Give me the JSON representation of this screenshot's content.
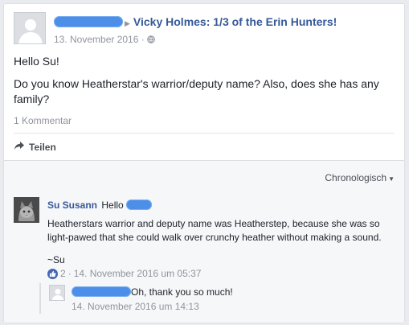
{
  "post": {
    "page_title": "Vicky Holmes: 1/3 of the Erin Hunters!",
    "date": "13. November 2016",
    "meta_separator": " · ",
    "body_lines": [
      "Hello Su!",
      "Do you know Heatherstar's warrior/deputy name? Also, does she has any family?"
    ],
    "comment_count": "1 Kommentar",
    "share_label": "Teilen"
  },
  "comments": {
    "sort_label": "Chronologisch",
    "main": {
      "author": "Su Susann",
      "mention_prefix": "Hello",
      "text": "Heatherstars warrior and deputy name was Heatherstep, because she was so light-pawed that she could walk over crunchy heather without making a sound.",
      "signature": "~Su",
      "like_count": "2",
      "meta_separator": "·",
      "timestamp": "14. November 2016 um 05:37"
    },
    "reply": {
      "text": "Oh, thank you so much!",
      "timestamp": "14. November 2016 um 14:13"
    }
  },
  "colors": {
    "link": "#365899",
    "muted": "#90949c",
    "redaction": "#4d8fe8",
    "like": "#4267b2"
  },
  "icons": [
    "default-avatar-icon",
    "arrow-right-icon",
    "globe-icon",
    "share-arrow-icon",
    "caret-down-icon",
    "like-icon",
    "cat-avatar"
  ]
}
